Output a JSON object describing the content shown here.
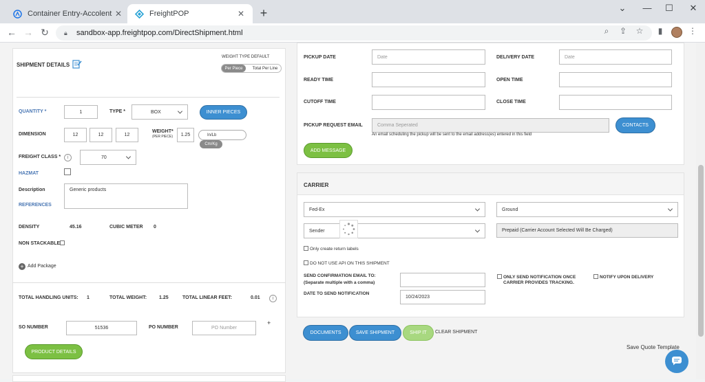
{
  "browser": {
    "tabs": [
      {
        "title": "Container Entry-Accolent ERP",
        "icon": "accolent-icon"
      },
      {
        "title": "FreightPOP",
        "icon": "freightpop-icon"
      }
    ],
    "url": "sandbox-app.freightpop.com/DirectShipment.html"
  },
  "shipment": {
    "title": "SHIPMENT DETAILS",
    "weight_type_label": "WEIGHT TYPE DEFAULT",
    "toggle_per_piece": "Per Piece",
    "toggle_total_per_line": "Total Per Line",
    "quantity_label": "QUANTITY *",
    "quantity_value": "1",
    "type_label": "TYPE *",
    "type_value": "BOX",
    "inner_pieces_label": "INNER PIECES",
    "dimension_label": "DIMENSION",
    "dim_l": "12",
    "dim_w": "12",
    "dim_h": "12",
    "weight_label": "WEIGHT*",
    "weight_sub": "(PER PIECE)",
    "weight_value": "1.25",
    "unit_imperial": "In/Lb",
    "unit_metric": "Cm/Kg",
    "freight_class_label": "FREIGHT CLASS *",
    "freight_class_value": "70",
    "hazmat_label": "HAZMAT",
    "description_label": "Description",
    "references_label": "REFERENCES",
    "description_value": "Generic products",
    "density_label": "DENSITY",
    "density_value": "45.16",
    "cubic_meter_label": "CUBIC METER",
    "cubic_meter_value": "0",
    "non_stackable_label": "NON STACKABLE",
    "add_package_label": "Add Package",
    "total_units_label": "TOTAL HANDLING UNITS:",
    "total_units_value": "1",
    "total_weight_label": "TOTAL WEIGHT:",
    "total_weight_value": "1.25",
    "total_linear_label": "TOTAL LINEAR FEET:",
    "total_linear_value": "0.01",
    "so_label": "SO NUMBER",
    "so_value": "51536",
    "po_label": "PO NUMBER",
    "po_placeholder": "PO Number",
    "product_details_label": "PRODUCT DETAILS"
  },
  "pickup": {
    "pickup_date_label": "PICKUP DATE",
    "pickup_date_placeholder": "Date",
    "delivery_date_label": "DELIVERY DATE",
    "delivery_date_placeholder": "Date",
    "ready_time_label": "READY TIME",
    "open_time_label": "OPEN TIME",
    "cutoff_time_label": "CUTOFF TIME",
    "close_time_label": "CLOSE TIME",
    "request_email_label": "PICKUP REQUEST EMAIL",
    "request_email_placeholder": "Comma Seperated",
    "contacts_label": "CONTACTS",
    "email_note": "An email scheduling the pickup will be sent to the email address(es) entered in this field",
    "add_message_label": "ADD MESSAGE"
  },
  "carrier": {
    "title": "CARRIER",
    "carrier_value": "Fed-Ex",
    "service_value": "Ground",
    "payer_value": "Sender",
    "billing_value": "Prepaid (Carrier Account Selected Will Be Charged)",
    "return_labels_label": "Only create return labels",
    "no_api_label": "DO NOT USE API ON THIS SHIPMENT",
    "send_email_label": "SEND CONFIRMATION EMAIL TO:",
    "send_email_sub": "(Separate multiple with a comma)",
    "notify_once_label": "ONLY SEND NOTIFICATION ONCE CARRIER PROVIDES TRACKING.",
    "notify_delivery_label": "NOTIFY UPON DELIVERY",
    "date_notify_label": "DATE TO SEND NOTIFICATION",
    "date_notify_value": "10/24/2023"
  },
  "actions": {
    "documents": "DOCUMENTS",
    "save_shipment": "SAVE SHIPMENT",
    "ship_it": "SHIP IT",
    "clear_shipment": "CLEAR SHIPMENT",
    "save_quote_template": "Save Quote Template"
  }
}
